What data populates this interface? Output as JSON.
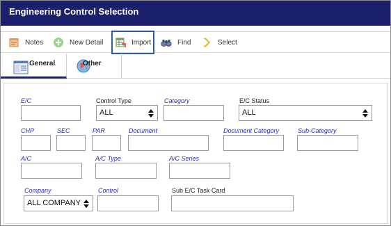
{
  "window": {
    "title": "Engineering Control Selection"
  },
  "toolbar": {
    "notes_label": "Notes",
    "new_detail_label": "New Detail",
    "import_label": "Import",
    "find_label": "Find",
    "select_label": "Select"
  },
  "tabs": [
    {
      "label": "General",
      "icon": "general-form-icon",
      "active": true
    },
    {
      "label": "Other",
      "icon": "globe-icon",
      "active": false
    }
  ],
  "form": {
    "ec": {
      "label": "E/C",
      "value": ""
    },
    "control_type": {
      "label": "Control Type",
      "value": "ALL"
    },
    "category": {
      "label": "Category",
      "value": ""
    },
    "ec_status": {
      "label": "E/C Status",
      "value": "ALL"
    },
    "chp": {
      "label": "CHP",
      "value": ""
    },
    "sec": {
      "label": "SEC",
      "value": ""
    },
    "par": {
      "label": "PAR",
      "value": ""
    },
    "document": {
      "label": "Document",
      "value": ""
    },
    "document_category": {
      "label": "Document Category",
      "value": ""
    },
    "sub_category": {
      "label": "Sub-Category",
      "value": ""
    },
    "ac": {
      "label": "A/C",
      "value": ""
    },
    "ac_type": {
      "label": "A/C Type",
      "value": ""
    },
    "ac_series": {
      "label": "A/C Series",
      "value": ""
    },
    "company": {
      "label": "Company",
      "value": "ALL COMPANY"
    },
    "control": {
      "label": "Control",
      "value": ""
    },
    "sub_ec_task_card": {
      "label": "Sub E/C Task Card",
      "value": ""
    }
  },
  "colors": {
    "titlebar": "#1c1f6b",
    "required_label": "#2b2bb5",
    "selected_outline": "#2c5fa0"
  }
}
